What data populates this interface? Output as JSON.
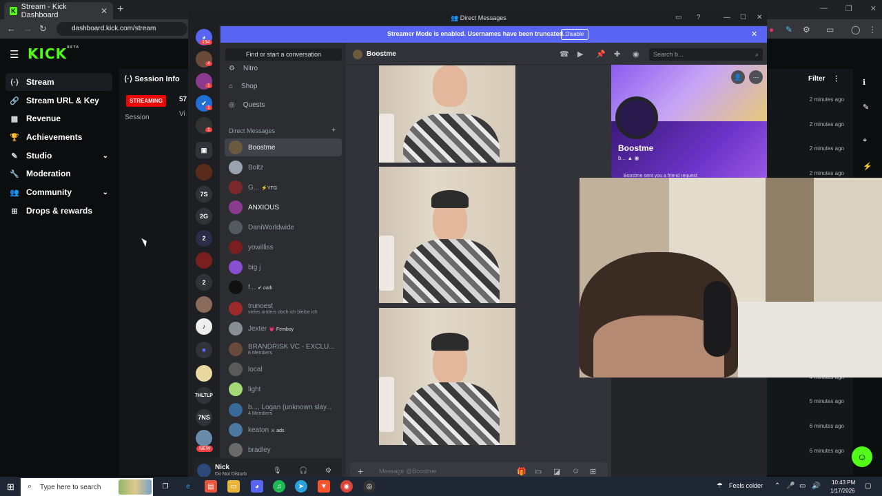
{
  "browser": {
    "tab_title": "Stream - Kick Dashboard",
    "tab_favicon": "K",
    "url": "dashboard.kick.com/stream"
  },
  "kick": {
    "logo": "KICK",
    "logo_sup": "BETA",
    "nav": [
      {
        "label": "Stream",
        "icon": "stream-icon"
      },
      {
        "label": "Stream URL & Key",
        "icon": "link-icon"
      },
      {
        "label": "Revenue",
        "icon": "revenue-icon"
      },
      {
        "label": "Achievements",
        "icon": "trophy-icon"
      },
      {
        "label": "Studio",
        "icon": "brush-icon"
      },
      {
        "label": "Moderation",
        "icon": "wrench-icon"
      },
      {
        "label": "Community",
        "icon": "community-icon"
      },
      {
        "label": "Drops & rewards",
        "icon": "drops-icon"
      }
    ],
    "session_title": "Session Info",
    "status_badge": "STREAMING",
    "count": "57",
    "session_label": "Session",
    "viewers_label": "Vi",
    "filter_label": "Filter",
    "event_times": [
      "2 minutes ago",
      "2 minutes ago",
      "2 minutes ago",
      "2 minutes ago",
      "4 minutes ago",
      "5 minutes ago",
      "6 minutes ago",
      "6 minutes ago"
    ]
  },
  "discord": {
    "window_title": "Direct Messages",
    "guild_badges": {
      "home": "134",
      "g1": "4",
      "g2": "1",
      "g3": "1",
      "g4": "1"
    },
    "guild_labels": [
      "7S",
      "2G",
      "2",
      "2",
      "7HLTLP",
      "7NS",
      "NEW"
    ],
    "banner_text": "Streamer Mode is enabled. Usernames have been truncated.",
    "banner_button": "Disable",
    "find_button": "Find or start a conversation",
    "side_nav": [
      "Nitro",
      "Shop",
      "Quests"
    ],
    "dm_header": "Direct Messages",
    "dms": [
      {
        "name": "Boostme",
        "color": "#6b5a3e"
      },
      {
        "name": "Boltz",
        "color": "#9aa3ad"
      },
      {
        "name": "G...",
        "tag": "⚡YTG",
        "color": "#7a2a2a"
      },
      {
        "name": "ANXIOUS",
        "color": "#8a3b8f"
      },
      {
        "name": "DaniWorldwide",
        "color": "#555a60"
      },
      {
        "name": "yowilliss",
        "color": "#7a1f1f"
      },
      {
        "name": "big j",
        "color": "#8a4fd0"
      },
      {
        "name": "f...",
        "tag": "✔ oath",
        "color": "#111111"
      },
      {
        "name": "trunoest",
        "sub": "vieles anders doch ich bleibe ich",
        "color": "#9c2a2a"
      },
      {
        "name": "Jexter",
        "tag": "💗 Femboy",
        "color": "#8a8f95"
      },
      {
        "name": "BRANDRISK VC - EXCLU...",
        "sub": "8 Members",
        "color": "#6a4a3a"
      },
      {
        "name": "local",
        "color": "#5a5a5a"
      },
      {
        "name": "light",
        "color": "#a3d977"
      },
      {
        "name": "b..., Logan (unknown slay...",
        "sub": "4 Members",
        "color": "#3a6a9a"
      },
      {
        "name": "keaton",
        "tag": "⚔ ads",
        "color": "#4a7aa0"
      },
      {
        "name": "bradley",
        "color": "#6a6a6a"
      }
    ],
    "user_name": "Nick",
    "user_status": "Do Not Disturb",
    "chat_name": "Boostme",
    "search_placeholder": "Search b...",
    "message_placeholder": "Message @Boostme",
    "profile_name": "Boostme",
    "profile_sub": "b...",
    "profile_sent": "Boostme sent you a friend request"
  },
  "taskbar": {
    "search_placeholder": "Type here to search",
    "weather": "Feels colder",
    "time": "10:43 PM",
    "date": "1/17/2026"
  }
}
